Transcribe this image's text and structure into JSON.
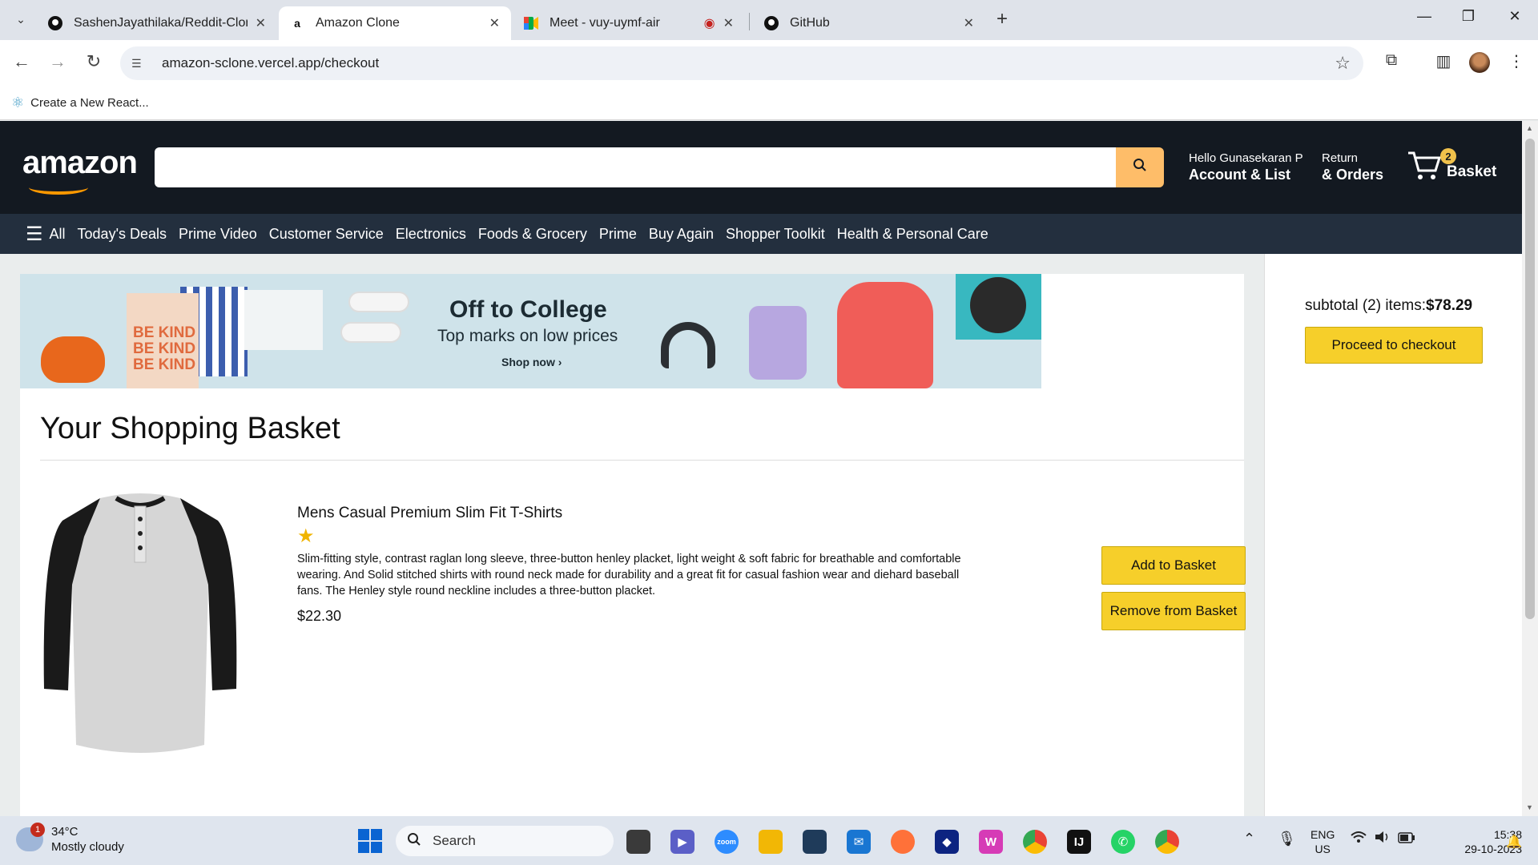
{
  "browser": {
    "tabs": [
      {
        "label": "SashenJayathilaka/Reddit-Clon",
        "favicon": "github-icon",
        "active": false
      },
      {
        "label": "Amazon Clone",
        "favicon": "amazon-icon",
        "active": true
      },
      {
        "label": "Meet - vuy-uymf-air",
        "favicon": "meet-icon",
        "active": false
      },
      {
        "label": "GitHub",
        "favicon": "github-icon",
        "active": false
      }
    ],
    "url": "amazon-sclone.vercel.app/checkout",
    "bookmark": "Create a New React..."
  },
  "header": {
    "logo": "amazon",
    "search_placeholder": "",
    "greeting": "Hello Gunasekaran P",
    "account_label": "Account & List",
    "returns_line1": "Return",
    "returns_line2": "& Orders",
    "basket_count": "2",
    "basket_label": "Basket"
  },
  "subnav": {
    "all_label": "All",
    "items": [
      "Today's Deals",
      "Prime Video",
      "Customer Service",
      "Electronics",
      "Foods & Grocery",
      "Prime",
      "Buy Again",
      "Shopper Toolkit",
      "Health & Personal Care"
    ]
  },
  "ad": {
    "headline": "Off to College",
    "subline": "Top marks on low prices",
    "cta": "Shop now ›",
    "shirt_text": "BE KIND"
  },
  "checkout": {
    "title": "Your Shopping Basket",
    "subtotal_label": "subtotal (2) items:",
    "subtotal_value": "$78.29",
    "proceed_label": "Proceed to checkout",
    "product": {
      "title": "Mens Casual Premium Slim Fit T-Shirts",
      "rating_stars": "★",
      "description": "Slim-fitting style, contrast raglan long sleeve, three-button henley placket, light weight & soft fabric for breathable and comfortable wearing. And Solid stitched shirts with round neck made for durability and a great fit for casual fashion wear and diehard baseball fans. The Henley style round neckline includes a three-button placket.",
      "price": "$22.30",
      "add_label": "Add to Basket",
      "remove_label": "Remove from Basket"
    }
  },
  "taskbar": {
    "weather_temp": "34°C",
    "weather_desc": "Mostly cloudy",
    "weather_badge": "1",
    "search_label": "Search",
    "lang_line1": "ENG",
    "lang_line2": "US",
    "time": "15:38",
    "date": "29-10-2023"
  },
  "colors": {
    "amazon_dark": "#131921",
    "amazon_nav": "#232f3e",
    "amazon_orange": "#ff9900",
    "button_yellow": "#f6cf2a"
  }
}
